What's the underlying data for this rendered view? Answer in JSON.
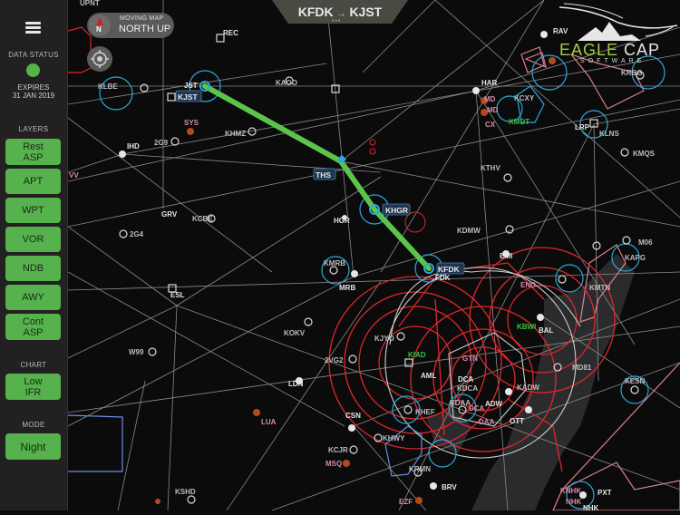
{
  "sidebar": {
    "data_status_label": "DATA STATUS",
    "status_color": "#53b548",
    "expires_label": "EXPIRES",
    "expires_date": "31 JAN 2019",
    "layers_label": "LAYERS",
    "layers": [
      {
        "label": "Rest\nASP"
      },
      {
        "label": "APT"
      },
      {
        "label": "WPT"
      },
      {
        "label": "VOR"
      },
      {
        "label": "NDB"
      },
      {
        "label": "AWY"
      },
      {
        "label": "Cont\nASP"
      }
    ],
    "chart_label": "CHART",
    "chart_value": "Low\nIFR",
    "mode_label": "MODE",
    "mode_value": "Night"
  },
  "route": {
    "from": "KFDK",
    "arrow": "→",
    "to": "KJST",
    "page_dots": "•••"
  },
  "map_mode": {
    "compass_letter": "N",
    "label": "MOVING MAP",
    "value": "NORTH UP"
  },
  "logo": {
    "word1": "EAGLE",
    "word2": "CAP",
    "sub": "SOFTWARE"
  },
  "colors": {
    "route_line": "#5cc44a",
    "button_green": "#56b24c",
    "airspace_red": "#e0262a",
    "class_b_white": "#cfcfcf",
    "class_d_blue": "#2aa8d8",
    "moa_pink": "#d98090",
    "highlight_label_bg": "#1f3550"
  },
  "map": {
    "route_waypoints": [
      "KJST",
      "THS",
      "KHGR",
      "KFDK"
    ],
    "labels": [
      {
        "text": "UPNT",
        "kind": "wpt"
      },
      {
        "text": "REC",
        "kind": "vor"
      },
      {
        "text": "RAV",
        "kind": "vor"
      },
      {
        "text": "KLBE",
        "kind": "apt"
      },
      {
        "text": "JST",
        "kind": "vor"
      },
      {
        "text": "KJST",
        "kind": "route"
      },
      {
        "text": "KAOO",
        "kind": "apt"
      },
      {
        "text": "HAR",
        "kind": "vor"
      },
      {
        "text": "MD",
        "kind": "pink"
      },
      {
        "text": "KCXY",
        "kind": "apt"
      },
      {
        "text": "MD",
        "kind": "pink"
      },
      {
        "text": "CX",
        "kind": "pink"
      },
      {
        "text": "KMDT",
        "kind": "green"
      },
      {
        "text": "KRDG",
        "kind": "apt"
      },
      {
        "text": "LRP",
        "kind": "vor"
      },
      {
        "text": "KLNS",
        "kind": "apt"
      },
      {
        "text": "SYS",
        "kind": "pink"
      },
      {
        "text": "2G9",
        "kind": "apt"
      },
      {
        "text": "KHMZ",
        "kind": "apt"
      },
      {
        "text": "IHD",
        "kind": "vor"
      },
      {
        "text": "VV",
        "kind": "pink"
      },
      {
        "text": "THS",
        "kind": "route"
      },
      {
        "text": "KTHV",
        "kind": "apt"
      },
      {
        "text": "KMQS",
        "kind": "apt"
      },
      {
        "text": "GRV",
        "kind": "vor"
      },
      {
        "text": "KCBE",
        "kind": "apt"
      },
      {
        "text": "2G4",
        "kind": "apt"
      },
      {
        "text": "HGR",
        "kind": "vor"
      },
      {
        "text": "KHGR",
        "kind": "route"
      },
      {
        "text": "KDMW",
        "kind": "apt"
      },
      {
        "text": "M06",
        "kind": "apt"
      },
      {
        "text": "KAPG",
        "kind": "apt"
      },
      {
        "text": "EMI",
        "kind": "vor"
      },
      {
        "text": "KMRB",
        "kind": "apt"
      },
      {
        "text": "MRB",
        "kind": "vor"
      },
      {
        "text": "KFDK",
        "kind": "route"
      },
      {
        "text": "FDK",
        "kind": "vor"
      },
      {
        "text": "ESL",
        "kind": "vor"
      },
      {
        "text": "END",
        "kind": "pink"
      },
      {
        "text": "KMTN",
        "kind": "apt"
      },
      {
        "text": "KOKV",
        "kind": "apt"
      },
      {
        "text": "KJYO",
        "kind": "apt"
      },
      {
        "text": "KBWI",
        "kind": "green"
      },
      {
        "text": "BAL",
        "kind": "vor"
      },
      {
        "text": "W99",
        "kind": "apt"
      },
      {
        "text": "2VG2",
        "kind": "apt"
      },
      {
        "text": "KIAD",
        "kind": "green"
      },
      {
        "text": "AML",
        "kind": "vor"
      },
      {
        "text": "GTN",
        "kind": "pink"
      },
      {
        "text": "DCA",
        "kind": "vor"
      },
      {
        "text": "KDCA",
        "kind": "apt"
      },
      {
        "text": "KADW",
        "kind": "apt"
      },
      {
        "text": "MD81",
        "kind": "apt"
      },
      {
        "text": "LDN",
        "kind": "vor"
      },
      {
        "text": "KHEF",
        "kind": "apt"
      },
      {
        "text": "KDAA",
        "kind": "apt"
      },
      {
        "text": "DCA",
        "kind": "pink"
      },
      {
        "text": "ADW",
        "kind": "vor"
      },
      {
        "text": "KESN",
        "kind": "apt"
      },
      {
        "text": "DAA",
        "kind": "pink"
      },
      {
        "text": "OTT",
        "kind": "vor"
      },
      {
        "text": "LUA",
        "kind": "pink"
      },
      {
        "text": "CSN",
        "kind": "vor"
      },
      {
        "text": "KHWY",
        "kind": "apt"
      },
      {
        "text": "KCJR",
        "kind": "apt"
      },
      {
        "text": "MSQ",
        "kind": "pink"
      },
      {
        "text": "KRMN",
        "kind": "apt"
      },
      {
        "text": "KSHD",
        "kind": "apt"
      },
      {
        "text": "BRV",
        "kind": "vor"
      },
      {
        "text": "EZF",
        "kind": "pink"
      },
      {
        "text": "KNHK",
        "kind": "pink"
      },
      {
        "text": "PXT",
        "kind": "vor"
      },
      {
        "text": "NHK",
        "kind": "pink"
      },
      {
        "text": "NHK",
        "kind": "vor"
      }
    ]
  }
}
